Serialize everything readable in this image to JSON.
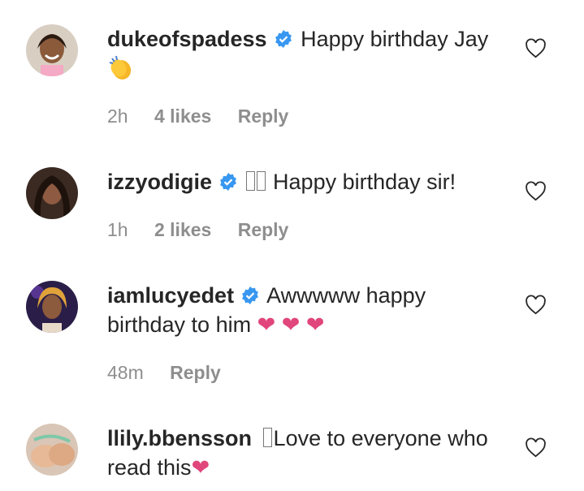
{
  "comments": [
    {
      "username": "dukeofspadess",
      "verified": true,
      "text": "Happy birthday Jay",
      "time": "2h",
      "likes": "4 likes",
      "reply": "Reply",
      "emoji_after": "clapping-hands"
    },
    {
      "username": "izzyodigie",
      "verified": true,
      "text": "Happy birthday sir!",
      "time": "1h",
      "likes": "2 likes",
      "reply": "Reply"
    },
    {
      "username": "iamlucyedet",
      "verified": true,
      "text": "Awwwww happy birthday to him",
      "time": "48m",
      "reply": "Reply"
    },
    {
      "username": "llily.bbensson",
      "verified": false,
      "text": "Love to everyone who read this",
      "emoji_after": "pink-heart"
    }
  ],
  "colors": {
    "text": "#262626",
    "meta": "#8e8e8e",
    "verified_blue": "#3897f0",
    "heart_pink": "#e0457b"
  }
}
